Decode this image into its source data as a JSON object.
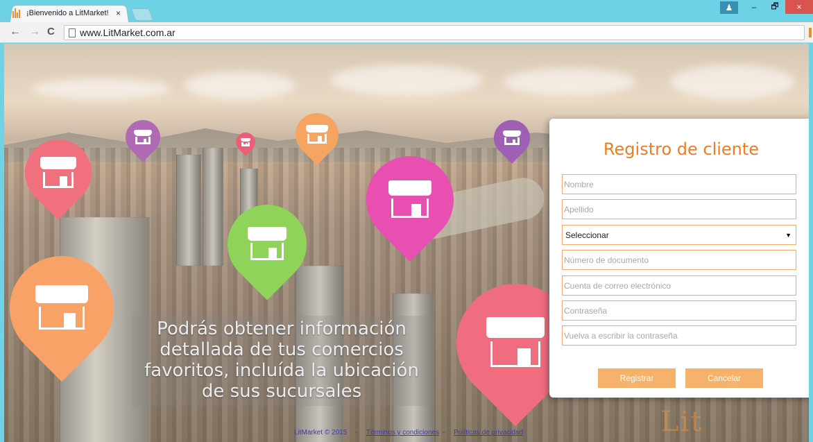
{
  "browser": {
    "tab_title": "¡Bienvenido a LitMarket!",
    "tab_close": "×",
    "url": "www.LitMarket.com.ar",
    "back_icon": "←",
    "forward_icon": "→",
    "reload_icon": "C",
    "minimize": "–",
    "restore": "🗗",
    "close": "×",
    "user_icon": "♟"
  },
  "hero": {
    "promo_text": "Podrás obtener información detallada de tus comercios favoritos, incluída la ubicación de sus sucursales"
  },
  "form": {
    "title": "Registro de cliente",
    "nombre_placeholder": "Nombre",
    "apellido_placeholder": "Apellido",
    "documento_tipo_value": "Seleccionar",
    "documento_numero_placeholder": "Número de documento",
    "email_placeholder": "Cuenta de correo electrónico",
    "password_placeholder": "Contraseña",
    "password_repeat_placeholder": "Vuelva a escribir la contraseña",
    "register_label": "Registrar",
    "cancel_label": "Cancelar"
  },
  "footer": {
    "copyright": "LitMarket © 2015",
    "sep1": "-",
    "terms": "Términos y condiciones",
    "sep2": "-",
    "privacy": "Políticas de privacidad"
  },
  "watermark": "Lit"
}
